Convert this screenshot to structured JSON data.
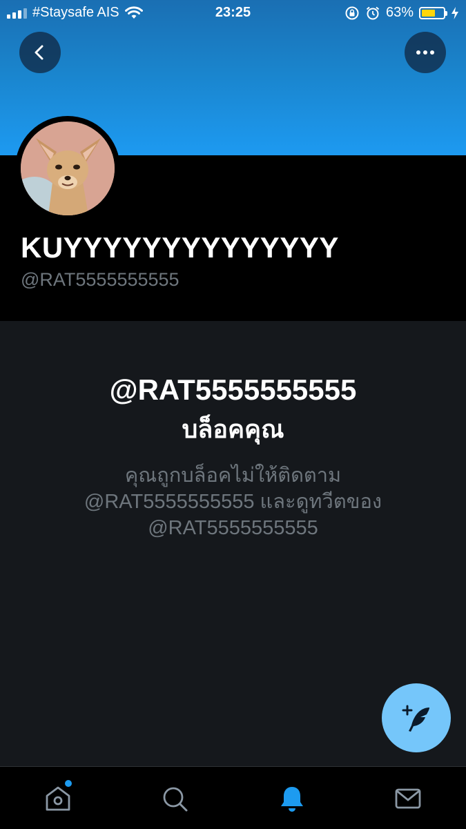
{
  "status_bar": {
    "carrier": "#Staysafe AIS",
    "time": "23:25",
    "battery": "63%",
    "battery_level": 0.63,
    "icons": [
      "signal-icon",
      "wifi-icon",
      "rotation-lock-icon",
      "alarm-icon",
      "battery-icon",
      "charging-icon"
    ]
  },
  "profile": {
    "display_name": "KUYYYYYYYYYYYYYY",
    "handle": "@RAT5555555555"
  },
  "blocked": {
    "title": "@RAT5555555555",
    "subtitle": "บล็อคคุณ",
    "desc_line1": "คุณถูกบล็อคไม่ให้ติดตาม",
    "desc_line2": "@RAT5555555555 และดูทวีตของ",
    "desc_line3": "@RAT5555555555"
  },
  "tabs": [
    "home-icon",
    "search-icon",
    "notifications-icon",
    "messages-icon"
  ],
  "colors": {
    "accent": "#1d9bf0",
    "fab": "#75c6fa",
    "background": "#15181c",
    "muted": "#6e767d"
  }
}
